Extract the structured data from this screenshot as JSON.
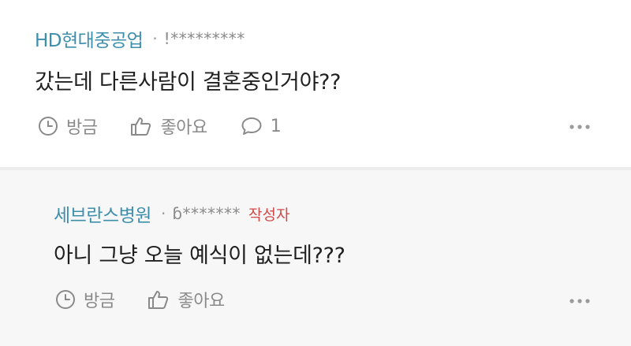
{
  "comments": [
    {
      "author": "HD현대중공업",
      "separator": "·",
      "masked_id": "!*********",
      "text": "갔는데 다른사람이 결혼중인거야??",
      "actions": {
        "time_label": "방금",
        "like_label": "좋아요",
        "reply_count": "1"
      }
    },
    {
      "author": "세브란스병원",
      "separator": "·",
      "masked_id": "ɓ*******",
      "badge": "작성자",
      "text": "아니 그냥 오늘 예식이 없는데???",
      "actions": {
        "time_label": "방금",
        "like_label": "좋아요"
      }
    }
  ],
  "colors": {
    "author": "#3d8fae",
    "badge": "#d24848",
    "muted": "#8a8a8a",
    "reply_bg": "#f7f7f7",
    "divider": "#ececec"
  },
  "icons": [
    "clock-icon",
    "thumbs-up-icon",
    "speech-bubble-icon",
    "more-dots-icon"
  ]
}
